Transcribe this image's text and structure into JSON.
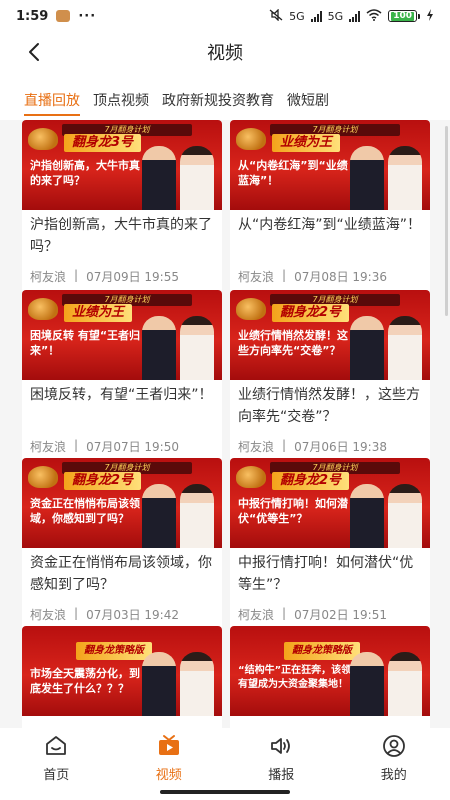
{
  "status_bar": {
    "time": "1:59",
    "dots": "···",
    "net_5g_1": "5G",
    "net_5g_2": "5G",
    "battery": "100",
    "icons": [
      "mute-icon",
      "signal-icon",
      "wifi-icon",
      "battery-icon",
      "charging-icon"
    ]
  },
  "header": {
    "title": "视频",
    "back_icon": "chevron-left-icon"
  },
  "tabs": [
    {
      "label": "直播回放",
      "active": true
    },
    {
      "label": "顶点视频",
      "active": false
    },
    {
      "label": "政府新规投资教育",
      "active": false
    },
    {
      "label": "微短剧",
      "active": false
    }
  ],
  "accent_color": "#e87014",
  "videos": [
    {
      "thumb_ribbon": "7月翻身计划",
      "thumb_brand": "翻身龙3号",
      "thumb_headline": "沪指创新高，大牛市真的来了吗？",
      "title": "沪指创新高，大牛市真的来了吗？",
      "author": "柯友浪",
      "time": "07月09日 19:55"
    },
    {
      "thumb_ribbon": "7月翻身计划",
      "thumb_brand": "业绩为王",
      "thumb_headline": "从“内卷红海”到“业绩蓝海”！",
      "title": "从“内卷红海”到“业绩蓝海”！",
      "author": "柯友浪",
      "time": "07月08日 19:36"
    },
    {
      "thumb_ribbon": "7月翻身计划",
      "thumb_brand": "业绩为王",
      "thumb_headline": "困境反转 有望“王者归来”！",
      "title": "困境反转，有望“王者归来”！",
      "author": "柯友浪",
      "time": "07月07日 19:50"
    },
    {
      "thumb_ribbon": "7月翻身计划",
      "thumb_brand": "翻身龙2号",
      "thumb_headline": "业绩行情悄然发酵！这些方向率先“交卷”？",
      "title": "业绩行情悄然发酵！，这些方向率先“交卷”？",
      "author": "柯友浪",
      "time": "07月06日 19:38"
    },
    {
      "thumb_ribbon": "7月翻身计划",
      "thumb_brand": "翻身龙2号",
      "thumb_headline": "资金正在悄悄布局该领域，你感知到了吗？",
      "title": "资金正在悄悄布局该领域，你感知到了吗？",
      "author": "柯友浪",
      "time": "07月03日 19:42"
    },
    {
      "thumb_ribbon": "7月翻身计划",
      "thumb_brand": "翻身龙2号",
      "thumb_headline": "中报行情打响！如何潜伏“优等生”？",
      "title": "中报行情打响！如何潜伏“优等生”？",
      "author": "柯友浪",
      "time": "07月02日 19:51"
    },
    {
      "thumb_ribbon": "",
      "thumb_brand": "翻身龙策略版",
      "thumb_headline": "市场全天震荡分化，到底发生了什么？？？",
      "title": "",
      "author": "",
      "time": ""
    },
    {
      "thumb_ribbon": "",
      "thumb_brand": "翻身龙策略版",
      "thumb_headline": "“结构牛”正在狂奔，该领域有望成为大资金聚集地！",
      "title": "",
      "author": "",
      "time": ""
    }
  ],
  "bottom_nav": [
    {
      "label": "首页",
      "icon": "home-icon",
      "active": false
    },
    {
      "label": "视频",
      "icon": "video-icon",
      "active": true
    },
    {
      "label": "播报",
      "icon": "speaker-icon",
      "active": false
    },
    {
      "label": "我的",
      "icon": "profile-icon",
      "active": false
    }
  ]
}
